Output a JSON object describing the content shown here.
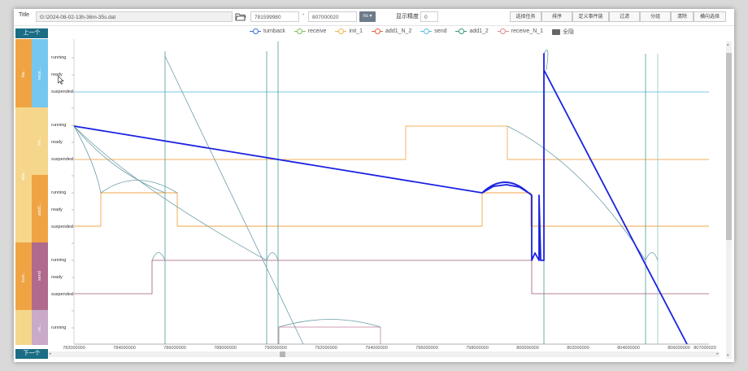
{
  "toolbar": {
    "title_label": "Title",
    "file_path": "G:\\2024-08-02-13h-36m-35s.dat",
    "start_value": "781599980",
    "range_sep": "-",
    "end_value": "807000020",
    "unit_label": "ns",
    "precision_label": "显示精度",
    "precision_value": "0",
    "buttons": [
      "选择任务",
      "排序",
      "定义事件链",
      "过滤",
      "分组",
      "清除",
      "横向选择"
    ]
  },
  "legend": {
    "items": [
      {
        "name": "turnback",
        "color": "#3f6dd8"
      },
      {
        "name": "receive",
        "color": "#7ec35a"
      },
      {
        "name": "init_1",
        "color": "#f1b54c"
      },
      {
        "name": "add1_N_2",
        "color": "#e0623f"
      },
      {
        "name": "send",
        "color": "#5fb9e0"
      },
      {
        "name": "add1_2",
        "color": "#3a9a6e"
      },
      {
        "name": "receive_N_1",
        "color": "#e08a8a"
      }
    ],
    "all_label": "全隐"
  },
  "nav": {
    "prev_label": "上一个",
    "next_label": "下一个"
  },
  "groups": {
    "g1": "ba...",
    "g2": "ada...",
    "g3": "turn...",
    "s1": "rece...",
    "s2": "init...",
    "s3": "add1...",
    "s4": "send",
    "s5": "re..."
  },
  "states": {
    "running": "running",
    "ready": "ready",
    "suspended": "suspended"
  },
  "xaxis": {
    "ticks": [
      "782000000",
      "784000000",
      "786000000",
      "788000000",
      "790000000",
      "792000000",
      "794000000",
      "796000000",
      "798000000",
      "800000000",
      "802000000",
      "804000000",
      "806000000",
      "807000020"
    ]
  },
  "colors": {
    "teal_line": "#5a9aa4",
    "blue_line": "#1a22e0",
    "orange_line": "#f2a64a",
    "maroon_line": "#a45a78",
    "cyan_line": "#5ec2e8"
  }
}
